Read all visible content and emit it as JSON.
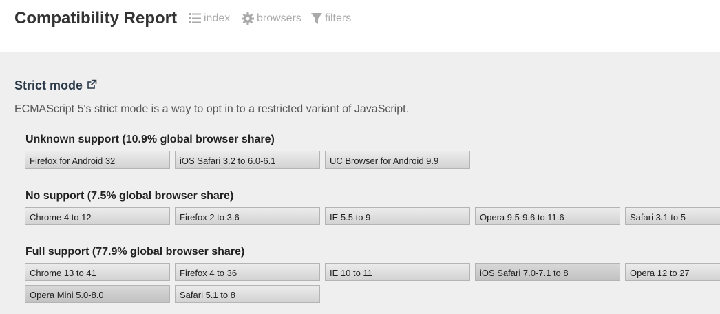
{
  "header": {
    "title": "Compatibility Report",
    "nav": [
      {
        "label": "index",
        "icon": "list-icon"
      },
      {
        "label": "browsers",
        "icon": "gear-icon"
      },
      {
        "label": "filters",
        "icon": "filter-icon"
      }
    ]
  },
  "feature": {
    "title": "Strict mode",
    "description": "ECMAScript 5's strict mode is a way to opt in to a restricted variant of JavaScript."
  },
  "groups": [
    {
      "heading": "Unknown support (10.9% global browser share)",
      "browsers": [
        "Firefox for Android 32",
        "iOS Safari 3.2 to 6.0-6.1",
        "UC Browser for Android 9.9"
      ]
    },
    {
      "heading": "No support (7.5% global browser share)",
      "browsers": [
        "Chrome 4 to 12",
        "Firefox 2 to 3.6",
        "IE 5.5 to 9",
        "Opera 9.5-9.6 to 11.6",
        "Safari 3.1 to 5"
      ]
    },
    {
      "heading": "Full support (77.9% global browser share)",
      "browsers": [
        "Chrome 13 to 41",
        "Firefox 4 to 36",
        "IE 10 to 11",
        "iOS Safari 7.0-7.1 to 8",
        "Opera 12 to 27",
        "Opera Mini 5.0-8.0",
        "Safari 5.1 to 8"
      ]
    }
  ],
  "colors": {
    "header_bg": "#ffffff",
    "page_bg": "#efefef",
    "nav_text": "#aaaaaa",
    "chip_bg": "#dcdcdc"
  }
}
